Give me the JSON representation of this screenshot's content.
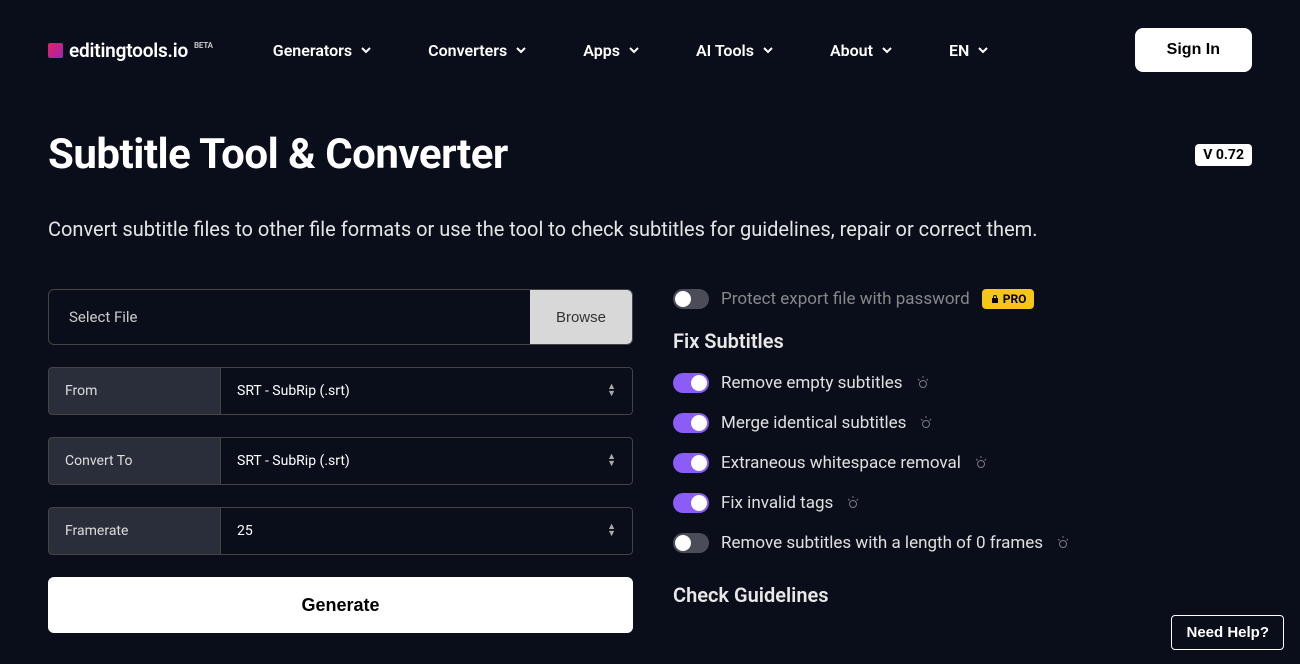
{
  "logo": {
    "text": "editingtools.io",
    "beta": "BETA"
  },
  "nav": {
    "generators": "Generators",
    "converters": "Converters",
    "apps": "Apps",
    "ai_tools": "AI Tools",
    "about": "About",
    "lang": "EN"
  },
  "sign_in": "Sign In",
  "page": {
    "title": "Subtitle Tool & Converter",
    "version": "V 0.72",
    "subtitle": "Convert subtitle files to other file formats or use the tool to check subtitles for guidelines, repair or correct them."
  },
  "form": {
    "select_file": "Select File",
    "browse": "Browse",
    "from_label": "From",
    "from_value": "SRT - SubRip (.srt)",
    "convert_label": "Convert To",
    "convert_value": "SRT - SubRip (.srt)",
    "framerate_label": "Framerate",
    "framerate_value": "25",
    "generate": "Generate"
  },
  "options": {
    "protect": "Protect export file with password",
    "pro": "PRO",
    "fix_heading": "Fix Subtitles",
    "remove_empty": "Remove empty subtitles",
    "merge_identical": "Merge identical subtitles",
    "whitespace": "Extraneous whitespace removal",
    "fix_tags": "Fix invalid tags",
    "zero_frames": "Remove subtitles with a length of 0 frames",
    "guidelines_heading": "Check Guidelines"
  },
  "need_help": "Need Help?"
}
